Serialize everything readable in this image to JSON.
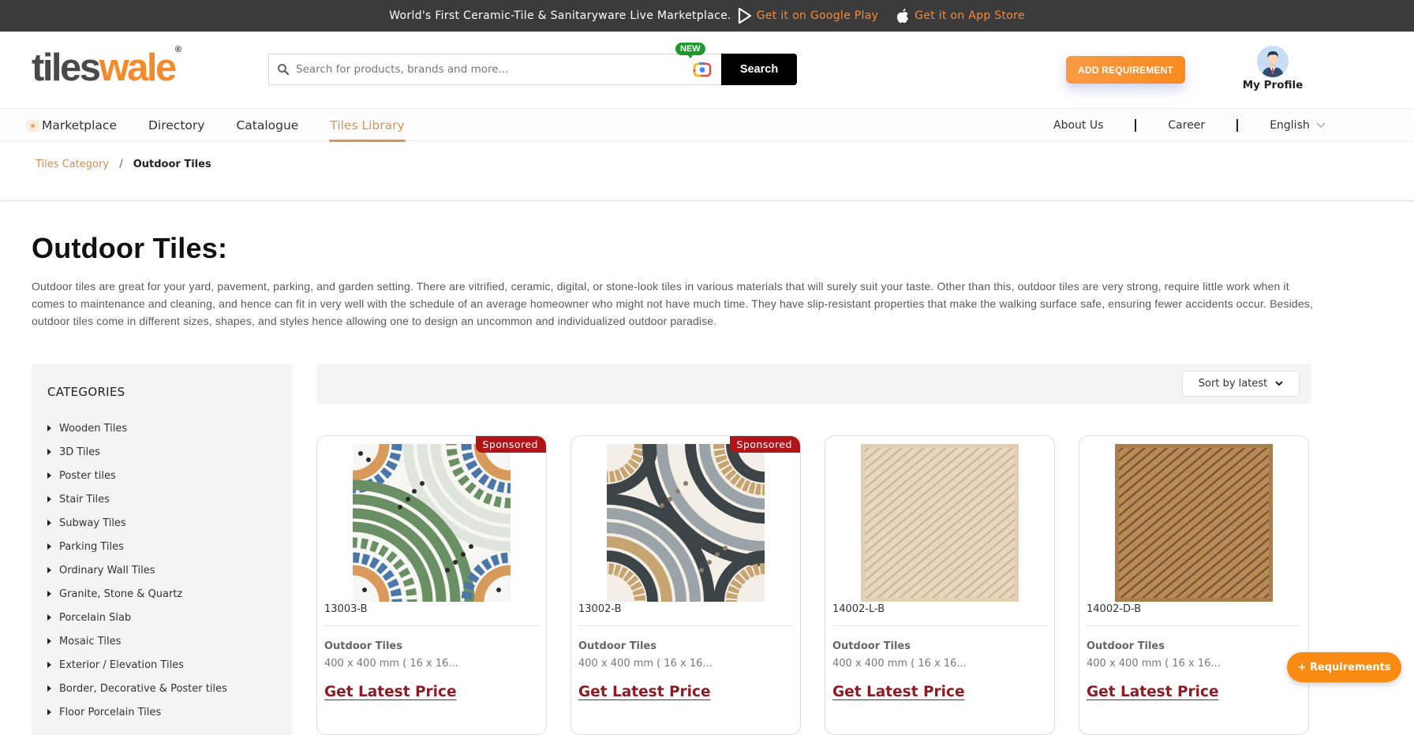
{
  "topbar": {
    "tagline": "World's First Ceramic-Tile & Sanitaryware Live Marketplace.",
    "google_play": "Get it on Google Play",
    "app_store": "Get it on App Store"
  },
  "brand": {
    "part1": "tiles",
    "part2": "wale",
    "reg": "®"
  },
  "search": {
    "placeholder": "Search for products, brands and more...",
    "value": "",
    "new_badge": "NEW",
    "button": "Search"
  },
  "header": {
    "add_requirement": "ADD REQUIREMENT",
    "profile_label": "My Profile"
  },
  "nav": {
    "items": [
      {
        "label": "Marketplace",
        "active": false
      },
      {
        "label": "Directory",
        "active": false
      },
      {
        "label": "Catalogue",
        "active": false
      },
      {
        "label": "Tiles Library",
        "active": true
      }
    ],
    "right": {
      "about": "About Us",
      "career": "Career",
      "language": "English"
    }
  },
  "breadcrumb": {
    "parent": "Tiles Category",
    "separator": "/",
    "current": "Outdoor Tiles"
  },
  "page": {
    "title": "Outdoor Tiles:",
    "description": "Outdoor tiles are great for your yard, pavement, parking, and garden setting. There are vitrified, ceramic, digital, or stone-look tiles in various materials that will surely suit your taste. Other than this, outdoor tiles are very strong, require little work when it comes to maintenance and cleaning, and hence can fit in very well with the schedule of an average homeowner who might not have much time. They have slip-resistant properties that make the walking surface safe, ensuring fewer accidents occur. Besides, outdoor tiles come in different sizes, shapes, and styles hence allowing one to design an uncommon and individualized outdoor paradise."
  },
  "sidebar": {
    "title": "CATEGORIES",
    "items": [
      "Wooden Tiles",
      "3D Tiles",
      "Poster tiles",
      "Stair Tiles",
      "Subway Tiles",
      "Parking Tiles",
      "Ordinary Wall Tiles",
      "Granite, Stone & Quartz",
      "Porcelain Slab",
      "Mosaic Tiles",
      "Exterior / Elevation Tiles",
      "Border, Decorative & Poster tiles",
      "Floor Porcelain Tiles"
    ]
  },
  "sort": {
    "selected": "Sort by latest"
  },
  "products": [
    {
      "code": "13003-B",
      "category": "Outdoor Tiles",
      "size": "400 x 400 mm ( 16 x 16...",
      "cta": "Get Latest Price",
      "sponsored": "Sponsored"
    },
    {
      "code": "13002-B",
      "category": "Outdoor Tiles",
      "size": "400 x 400 mm ( 16 x 16...",
      "cta": "Get Latest Price",
      "sponsored": "Sponsored"
    },
    {
      "code": "14002-L-B",
      "category": "Outdoor Tiles",
      "size": "400 x 400 mm ( 16 x 16...",
      "cta": "Get Latest Price",
      "sponsored": null
    },
    {
      "code": "14002-D-B",
      "category": "Outdoor Tiles",
      "size": "400 x 400 mm ( 16 x 16...",
      "cta": "Get Latest Price",
      "sponsored": null
    }
  ],
  "fab": {
    "label": "+ Requirements"
  },
  "colors": {
    "brand_orange": "#f38b2c",
    "nav_active": "#d8935a",
    "price_red": "#8c1c24",
    "sponsored_red": "#b0151a",
    "new_green": "#1d9a2d"
  }
}
